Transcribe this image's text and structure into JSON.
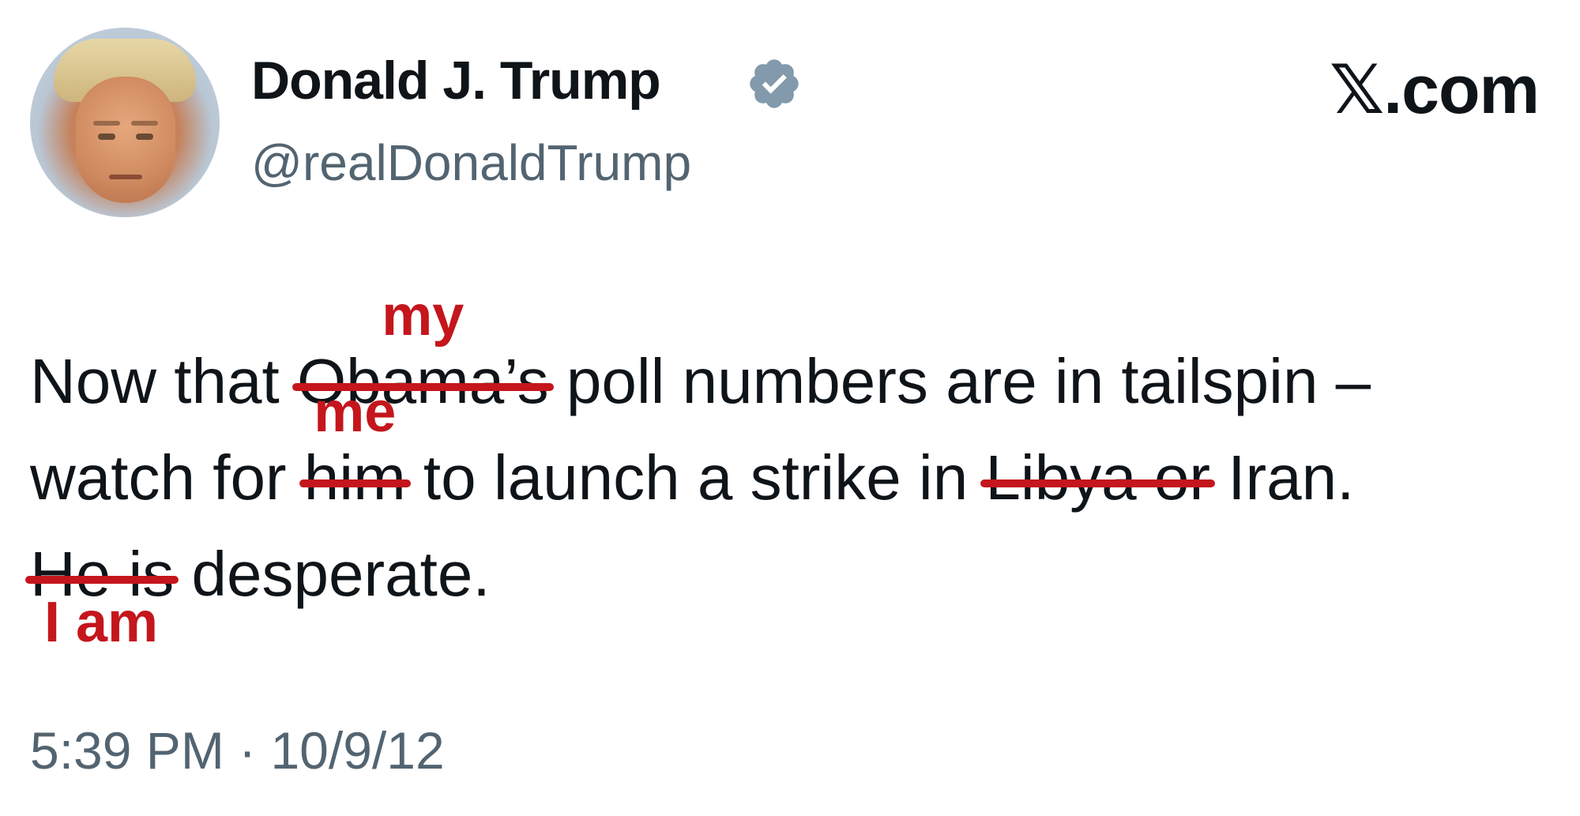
{
  "profile": {
    "display_name": "Donald J. Trump",
    "handle": "@realDonaldTrump",
    "avatar": "profile-photo",
    "verified_icon": "verified-badge-icon"
  },
  "brand": {
    "logo_text": "𝕏.com"
  },
  "tweet": {
    "line1": {
      "before": "Now that ",
      "struck": "Obama’s",
      "inserted": "my",
      "after": " poll numbers are in tailspin –"
    },
    "line2": {
      "before": "watch for ",
      "struck1": "him",
      "inserted1": "me",
      "middle": " to launch a strike in ",
      "struck2": "Libya or",
      "after": " Iran."
    },
    "line3": {
      "struck": "He is",
      "inserted": "I am",
      "after": " desperate."
    }
  },
  "timestamp": "5:39 PM · 10/9/12",
  "colors": {
    "edit_red": "#c4161c",
    "text": "#0f1419",
    "secondary": "#536471",
    "verified_grey": "#829aab"
  }
}
